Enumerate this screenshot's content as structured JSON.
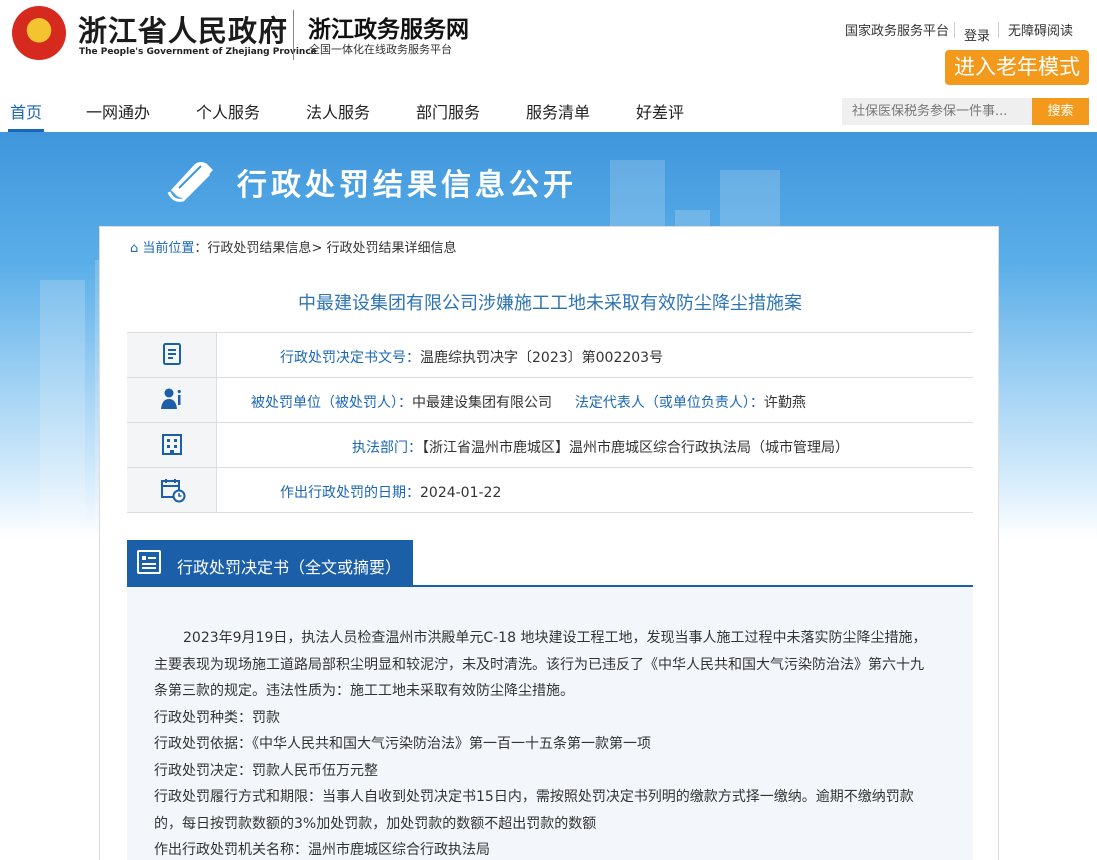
{
  "header": {
    "gov_title": "浙江省人民政府",
    "gov_subtitle": "The People's Government of Zhejiang Province",
    "service_title": "浙江政务服务网",
    "service_subtitle": "全国一体化在线政务服务平台",
    "links": {
      "national_platform": "国家政务服务平台",
      "login": "登录",
      "accessible": "无障碍阅读"
    },
    "elder_mode": "进入老年模式"
  },
  "nav": {
    "items": [
      "首页",
      "一网通办",
      "个人服务",
      "法人服务",
      "部门服务",
      "服务清单",
      "好差评"
    ],
    "search_placeholder": "社保医保税务参保一件事...",
    "search_button": "搜索"
  },
  "banner": {
    "title": "行政处罚结果信息公开"
  },
  "breadcrumb": {
    "current": "当前位置",
    "level1": "：行政处罚结果信息",
    "level2": "> 行政处罚结果详细信息"
  },
  "case": {
    "title": "中最建设集团有限公司涉嫌施工工地未采取有效防尘降尘措施案",
    "doc_number_label": "行政处罚决定书文号：",
    "doc_number": "温鹿综执罚决字〔2023〕第002203号",
    "party_label": "被处罚单位（被处罚人）：",
    "party": "中最建设集团有限公司",
    "legal_rep_label": "法定代表人（或单位负责人）：",
    "legal_rep": "许勤燕",
    "dept_label": "执法部门：",
    "dept": "【浙江省温州市鹿城区】温州市鹿城区综合行政执法局（城市管理局）",
    "date_label": "作出行政处罚的日期：",
    "date": "2024-01-22"
  },
  "decision": {
    "tab_label": "行政处罚决定书（全文或摘要）",
    "para1_line1": "2023年9月19日，执法人员检查温州市洪殿单元C-18 地块建设工程工地，发现当事人施工过程中未落实防尘降尘措施，",
    "para1_line2": "主要表现为现场施工道路局部积尘明显和较泥泞，未及时清洗。该行为已违反了《中华人民共和国大气污染防治法》第六十九",
    "para1_line3": "条第三款的规定。违法性质为：施工工地未采取有效防尘降尘措施。",
    "type": "行政处罚种类：罚款",
    "basis": "行政处罚依据：《中华人民共和国大气污染防治法》第一百一十五条第一款第一项",
    "penalty": "行政处罚决定：罚款人民币伍万元整",
    "method_line1": "行政处罚履行方式和期限：当事人自收到处罚决定书15日内，需按照处罚决定书列明的缴款方式择一缴纳。逾期不缴纳罚款",
    "method_line2": "的，每日按罚款数额的3%加处罚款，加处罚款的数额不超出罚款的数额",
    "authority": "作出行政处罚机关名称：温州市鹿城区综合行政执法局"
  },
  "colors": {
    "primary_blue": "#1b67b7",
    "orange": "#f39a1d",
    "tab_blue": "#1b5fa8"
  }
}
